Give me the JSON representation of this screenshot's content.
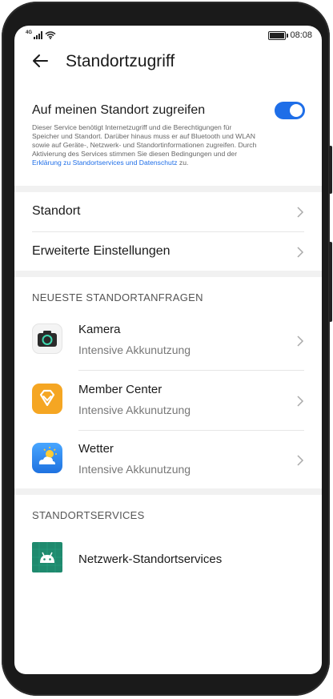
{
  "statusbar": {
    "network": "4G",
    "time": "08:08"
  },
  "header": {
    "title": "Standortzugriff"
  },
  "location_toggle": {
    "label": "Auf meinen Standort zugreifen",
    "enabled": true,
    "description_lines": [
      "Dieser Service benötigt Internetzugriff und die Berechtigungen für",
      "Speicher und Standort. Darüber hinaus muss er auf Bluetooth und WLAN",
      "sowie auf Geräte-, Netzwerk- und Standortinformationen zugreifen. Durch",
      "Aktivierung des Services stimmen Sie diesen Bedingungen und der"
    ],
    "link_text": "Erklärung zu Standortservices und Datenschutz",
    "link_suffix": " zu."
  },
  "settings": {
    "items": [
      {
        "label": "Standort"
      },
      {
        "label": "Erweiterte Einstellungen"
      }
    ]
  },
  "recent_requests": {
    "title": "NEUESTE STANDORTANFRAGEN",
    "apps": [
      {
        "name": "Kamera",
        "status": "Intensive Akkunutzung",
        "icon": "camera-icon"
      },
      {
        "name": "Member Center",
        "status": "Intensive Akkunutzung",
        "icon": "member-center-icon"
      },
      {
        "name": "Wetter",
        "status": "Intensive Akkunutzung",
        "icon": "weather-icon"
      }
    ]
  },
  "location_services": {
    "title": "STANDORTSERVICES",
    "items": [
      {
        "name": "Netzwerk-Standortservices",
        "icon": "android-icon"
      }
    ]
  },
  "colors": {
    "accent": "#1e6ee8",
    "member_center": "#f5a623",
    "weather": "#2f8cf5",
    "android": "#1f8a6e"
  }
}
